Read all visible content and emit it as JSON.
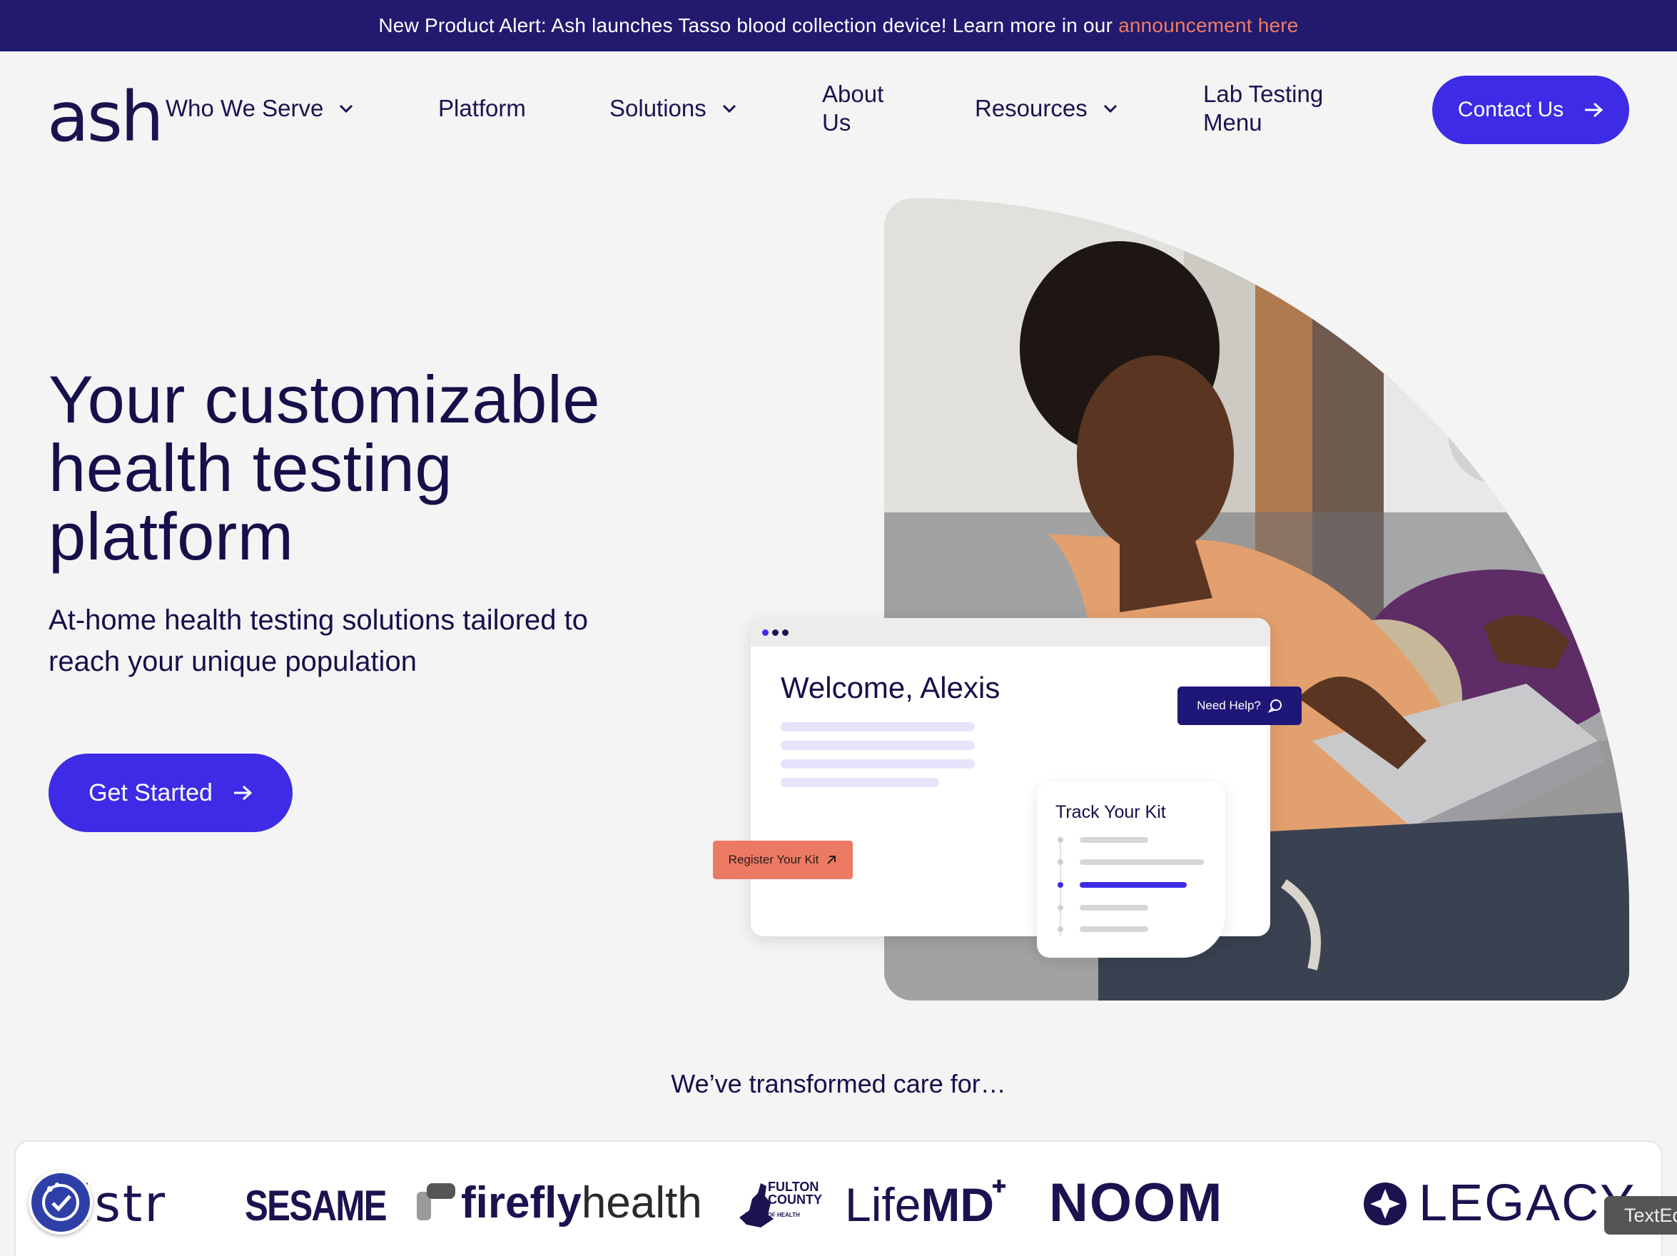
{
  "announcement": {
    "text": "New Product Alert: Ash launches Tasso blood collection device! Learn more in our",
    "link": "announcement here"
  },
  "nav": {
    "logo": "ash",
    "items": [
      {
        "label": "Who We Serve"
      },
      {
        "label": "Platform"
      },
      {
        "label": "Solutions"
      },
      {
        "label_line1": "About",
        "label_line2": "Us"
      },
      {
        "label": "Resources"
      },
      {
        "label_line1": "Lab Testing",
        "label_line2": "Menu"
      }
    ],
    "contact": "Contact Us"
  },
  "hero": {
    "title_line1": "Your customizable",
    "title_line2": "health testing",
    "title_line3": "platform",
    "subtitle_line1": "At-home health testing solutions tailored to",
    "subtitle_line2": "reach your unique population",
    "cta": "Get Started"
  },
  "dashboard": {
    "welcome": "Welcome, Alexis",
    "need_help": "Need Help?",
    "register": "Register Your Kit",
    "track_title": "Track Your Kit"
  },
  "transformed": "We’ve transformed care for…",
  "brands": {
    "istr": "istr",
    "sesame": "SESAME",
    "firefly_bold": "firefly",
    "firefly_thin": "health",
    "fulton_line1": "FULTON",
    "fulton_line2": "COUNTY",
    "fulton_line3": "BOARD OF HEALTH",
    "lifemd_thin": "Life",
    "lifemd_bold": "MD",
    "noom": "NOOM",
    "legacy": "LEGACY"
  },
  "texted_tab": "TextEd",
  "colors": {
    "accent": "#3d2be6",
    "navy": "#15104a",
    "announcement_bg": "#211a6e",
    "link": "#f07c62",
    "register_bg": "#ec7a62"
  }
}
